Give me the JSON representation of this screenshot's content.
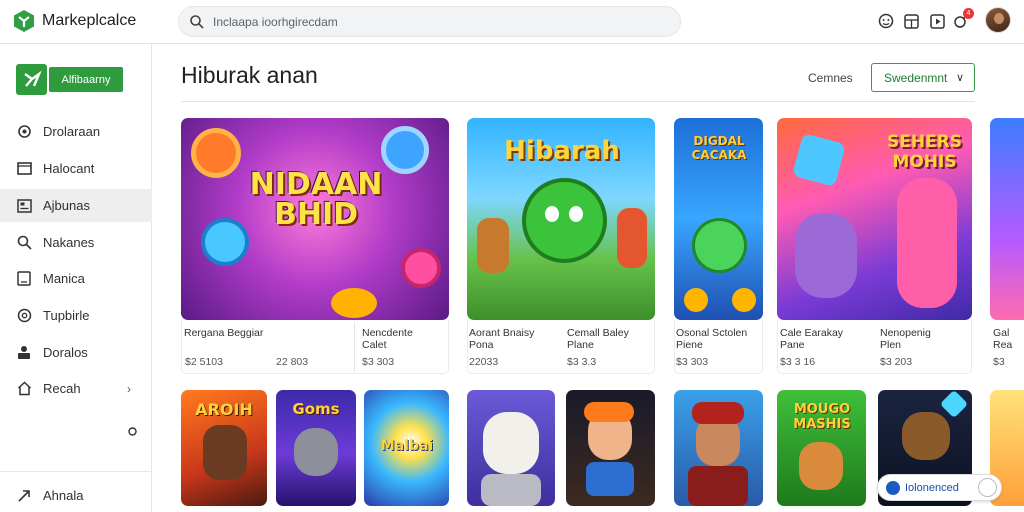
{
  "app": {
    "title": "Markeplcalce"
  },
  "search": {
    "placeholder": "Inclaapa ioorhgirecdam"
  },
  "notifications": {
    "count": "4"
  },
  "sidebar": {
    "brand_label": "Alfibaarny",
    "items": [
      {
        "label": "Drolaraan",
        "icon": "gear-icon"
      },
      {
        "label": "Halocant",
        "icon": "monitor-icon"
      },
      {
        "label": "Ajbunas",
        "icon": "image-icon"
      },
      {
        "label": "Nakanes",
        "icon": "search-icon"
      },
      {
        "label": "Manica",
        "icon": "tablet-icon"
      },
      {
        "label": "Tupbirle",
        "icon": "clock-icon"
      },
      {
        "label": "Doralos",
        "icon": "person-icon"
      },
      {
        "label": "Recah",
        "icon": "home-icon"
      }
    ],
    "footer_label": "Ahnala"
  },
  "main": {
    "title": "Hiburak anan",
    "sort_label": "Cemnes",
    "sort_value": "Swedenmnt"
  },
  "cards_row1": [
    {
      "art_title": "NIDAAN BHID",
      "name": "Rergana Beggiar",
      "sub": "",
      "price": "$2 5103"
    },
    {
      "art_title": "",
      "name": "",
      "sub": "",
      "price": "22 803"
    },
    {
      "art_title": "",
      "name": "Nencdente",
      "sub": "Calet",
      "price": "$3 303"
    },
    {
      "art_title": "Hibarah",
      "name": "Aorant Bnaisy",
      "sub": "Pona",
      "price": "22033"
    },
    {
      "art_title": "",
      "name": "Cemall Baley",
      "sub": "Plane",
      "price": "$3 3.3"
    },
    {
      "art_title": "DIGDAL CACAKA",
      "name": "Osonal Sctolen",
      "sub": "Piene",
      "price": "$3 303"
    },
    {
      "art_title": "",
      "name": "Cale Earakay",
      "sub": "Pane",
      "price": "$3 3 16"
    },
    {
      "art_title": "SEHERS MOHIS",
      "name": "Nenopenig",
      "sub": "Plen",
      "price": "$3 203"
    },
    {
      "art_title": "",
      "name": "Gal",
      "sub": "Rea",
      "price": "$3"
    }
  ],
  "cards_row2": [
    {
      "art_title": "AROIH"
    },
    {
      "art_title": "Goms"
    },
    {
      "art_title": "Malbai"
    },
    {
      "art_title": ""
    },
    {
      "art_title": ""
    },
    {
      "art_title": ""
    },
    {
      "art_title": "MOUGO MASHIS"
    },
    {
      "art_title": ""
    }
  ],
  "chip": {
    "label": "Iolonenced"
  },
  "colors": {
    "accent": "#2e9b3f",
    "active_bg": "#eeeeee"
  }
}
